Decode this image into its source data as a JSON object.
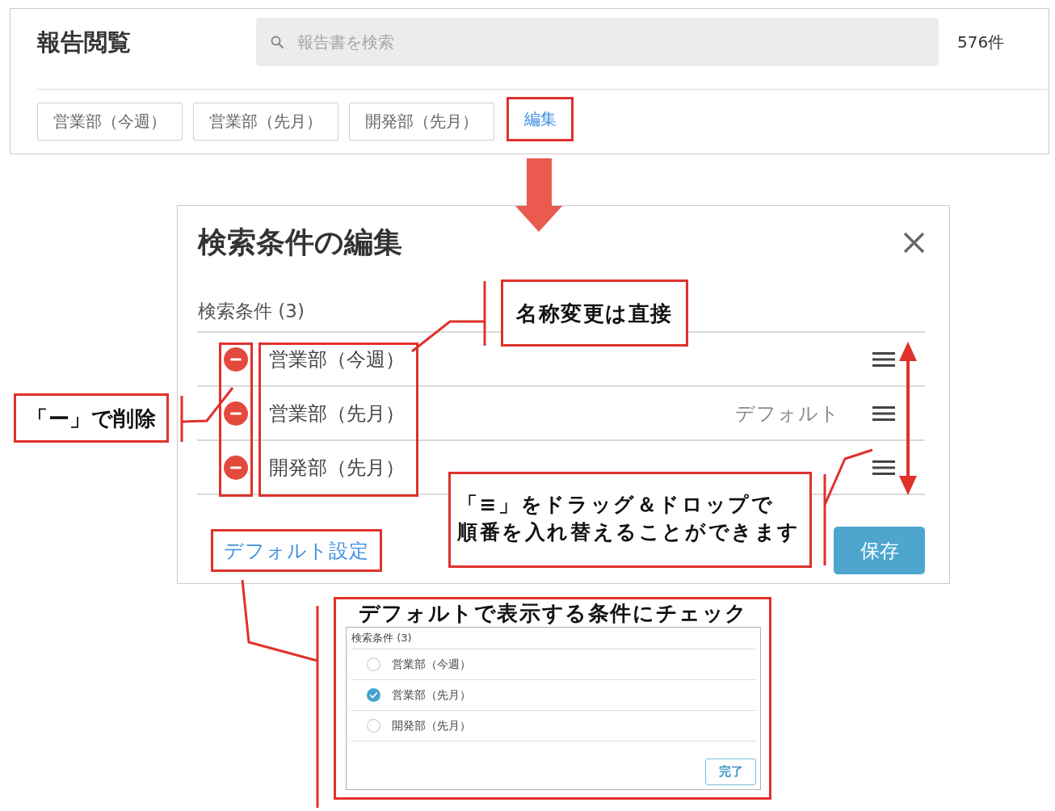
{
  "header": {
    "title": "報告閲覧",
    "search": {
      "placeholder": "報告書を検索"
    },
    "count": "576件"
  },
  "saved_searches": [
    "営業部（今週）",
    "営業部（先月）",
    "開発部（先月）"
  ],
  "edit_link": {
    "label": "編集",
    "highlighted": true
  },
  "modal": {
    "title": "検索条件の編集",
    "section_label": "検索条件 (3)",
    "highlight_delete_icons": true,
    "highlight_names": true,
    "conditions": [
      {
        "name": "営業部（今週）"
      },
      {
        "name": "営業部（先月）",
        "badge": "デフォルト"
      },
      {
        "name": "開発部（先月）"
      }
    ],
    "default_link": {
      "label": "デフォルト設定",
      "highlighted": true
    },
    "save_button": "保存"
  },
  "callouts": [
    {
      "lines": [
        "名称変更は直接"
      ]
    },
    {
      "lines": [
        "「ー」で削除"
      ]
    },
    {
      "lines": [
        "「≡」をドラッグ＆ドロップで",
        "順番を入れ替えることができます"
      ]
    }
  ],
  "default_inset": {
    "caption": "デフォルトで表示する条件にチェック",
    "section_label": "検索条件 (3)",
    "options": [
      {
        "label": "営業部（今週）",
        "checked": false
      },
      {
        "label": "営業部（先月）",
        "checked": true
      },
      {
        "label": "開発部（先月）",
        "checked": false
      }
    ],
    "done_button": "完了"
  }
}
